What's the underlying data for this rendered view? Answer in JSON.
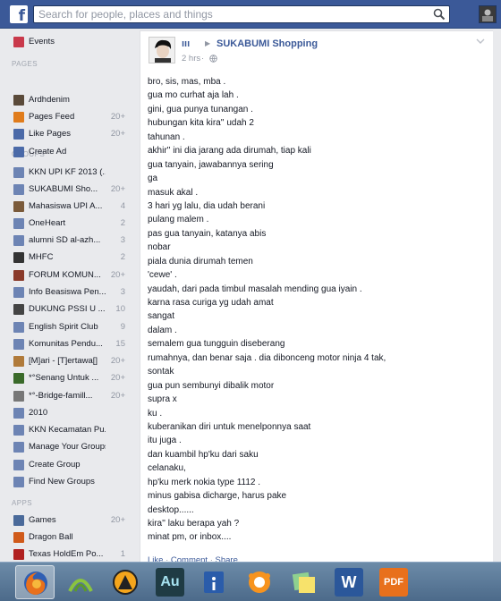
{
  "topbar": {
    "search_placeholder": "Search for people, places and things",
    "brand_color": "#3b5998"
  },
  "sidebar": {
    "items": [
      {
        "label": "Events",
        "count": "",
        "icon": "calendar-icon",
        "color": "#c9394b"
      },
      {
        "label": "Ardhdenim",
        "count": "",
        "icon": "page-icon",
        "color": "#5a4a3a"
      },
      {
        "label": "Pages Feed",
        "count": "20+",
        "icon": "pages-feed-icon",
        "color": "#e07c1c"
      },
      {
        "label": "Like Pages",
        "count": "20+",
        "icon": "like-pages-icon",
        "color": "#4b6aa8"
      },
      {
        "label": "Create Ad",
        "count": "",
        "icon": "create-ad-icon",
        "color": "#4b6aa8"
      },
      {
        "label": "KKN UPI KF 2013 (...",
        "count": "",
        "icon": "group-icon",
        "color": "#6d84b4"
      },
      {
        "label": "SUKABUMI Sho...",
        "count": "20+",
        "icon": "group-icon",
        "color": "#6d84b4"
      },
      {
        "label": "Mahasiswa UPI A...",
        "count": "4",
        "icon": "group-icon",
        "color": "#7a5a3a"
      },
      {
        "label": "OneHeart",
        "count": "2",
        "icon": "group-icon",
        "color": "#6d84b4"
      },
      {
        "label": "alumni SD al-azh...",
        "count": "3",
        "icon": "group-icon",
        "color": "#6d84b4"
      },
      {
        "label": "MHFC",
        "count": "2",
        "icon": "group-icon",
        "color": "#333333"
      },
      {
        "label": "FORUM KOMUN...",
        "count": "20+",
        "icon": "group-icon",
        "color": "#8a3a2a"
      },
      {
        "label": "Info Beasiswa Pen...",
        "count": "3",
        "icon": "group-icon",
        "color": "#6d84b4"
      },
      {
        "label": "DUKUNG PSSI U ...",
        "count": "10",
        "icon": "group-icon",
        "color": "#444444"
      },
      {
        "label": "English Spirit Club",
        "count": "9",
        "icon": "group-icon",
        "color": "#6d84b4"
      },
      {
        "label": "Komunitas Pendu...",
        "count": "15",
        "icon": "group-icon",
        "color": "#6d84b4"
      },
      {
        "label": "[M]ari - [T]ertawa[]",
        "count": "20+",
        "icon": "group-icon",
        "color": "#b07a3a"
      },
      {
        "label": "*°Senang Untuk ...",
        "count": "20+",
        "icon": "group-icon",
        "color": "#3a6a2a"
      },
      {
        "label": "*°-Bridge-famill...",
        "count": "20+",
        "icon": "group-icon",
        "color": "#777777"
      },
      {
        "label": "2010",
        "count": "",
        "icon": "group-icon",
        "color": "#6d84b4"
      },
      {
        "label": "KKN Kecamatan Pu...",
        "count": "",
        "icon": "group-icon",
        "color": "#6d84b4"
      },
      {
        "label": "Manage Your Groups",
        "count": "",
        "icon": "manage-groups-icon",
        "color": "#6d84b4"
      },
      {
        "label": "Create Group",
        "count": "",
        "icon": "create-group-icon",
        "color": "#6d84b4"
      },
      {
        "label": "Find New Groups",
        "count": "",
        "icon": "find-groups-icon",
        "color": "#6d84b4"
      },
      {
        "label": "Games",
        "count": "20+",
        "icon": "games-icon",
        "color": "#4a6a9a"
      },
      {
        "label": "Dragon Ball",
        "count": "",
        "icon": "app-icon",
        "color": "#d05a1a"
      },
      {
        "label": "Texas HoldEm Po...",
        "count": "1",
        "icon": "app-icon",
        "color": "#b02020"
      }
    ],
    "sections": {
      "pages": "PAGES",
      "groups": "GROUPS",
      "apps": "APPS"
    }
  },
  "post": {
    "author": "ııı",
    "group": "SUKABUMI Shopping",
    "time": "2 hrs",
    "time_sep": "·",
    "lines": [
      "bro, sis, mas, mba .",
      "gua mo curhat aja lah .",
      "gini, gua punya tunangan .",
      "hubungan kita kira'' udah 2",
      "tahunan .",
      "akhir'' ini dia jarang ada dirumah, tiap kali",
      "gua tanyain, jawabannya sering",
      "ga",
      "masuk akal .",
      "3 hari yg lalu, dia udah berani",
      "pulang malem .",
      "pas gua tanyain, katanya abis",
      "nobar",
      "piala dunia dirumah temen",
      "'cewe' .",
      "yaudah, dari pada timbul masalah mending gua iyain .",
      "karna rasa curiga yg udah amat",
      "sangat",
      "dalam .",
      "semalem gua tungguin diseberang",
      "rumahnya, dan benar saja . dia dibonceng motor ninja 4 tak,",
      "sontak",
      "gua pun sembunyi dibalik motor",
      "supra x",
      "ku .",
      "kuberanikan diri untuk menelponnya saat",
      "itu juga .",
      "dan kuambil hp'ku dari saku",
      "celanaku,",
      "hp'ku merk nokia type 1112 .",
      "minus gabisa dicharge, harus pake",
      "desktop......",
      "kira'' laku berapa yah ?",
      "minat pm, or inbox...."
    ],
    "actions": {
      "like": "Like",
      "comment": "Comment",
      "share": "Share",
      "sep": "·"
    }
  },
  "taskbar": {
    "apps": [
      {
        "name": "firefox-icon",
        "label": ""
      },
      {
        "name": "wifi-manager-icon",
        "label": ""
      },
      {
        "name": "aimp-icon",
        "label": ""
      },
      {
        "name": "audition-icon",
        "label": "Au"
      },
      {
        "name": "info-app-icon",
        "label": ""
      },
      {
        "name": "avast-icon",
        "label": ""
      },
      {
        "name": "sticky-notes-icon",
        "label": ""
      },
      {
        "name": "word-icon",
        "label": "W"
      },
      {
        "name": "pdf-icon",
        "label": "PDF"
      }
    ]
  }
}
